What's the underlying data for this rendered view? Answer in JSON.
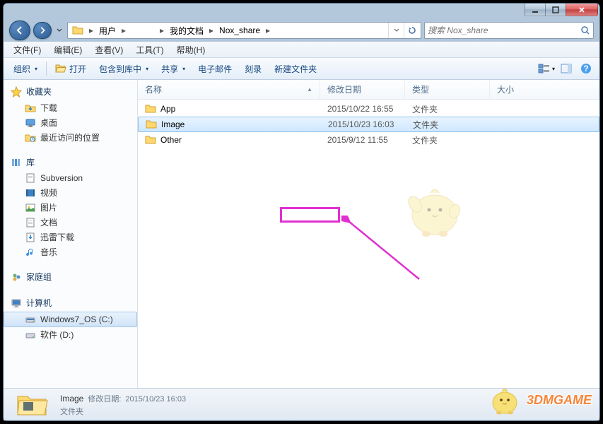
{
  "breadcrumb": {
    "segments": [
      "用户",
      "",
      "我的文档",
      "Nox_share"
    ]
  },
  "search": {
    "placeholder": "搜索 Nox_share"
  },
  "menu": {
    "file": "文件(F)",
    "edit": "编辑(E)",
    "view": "查看(V)",
    "tools": "工具(T)",
    "help": "帮助(H)"
  },
  "toolbar": {
    "organize": "组织",
    "open": "打开",
    "include": "包含到库中",
    "share": "共享",
    "email": "电子邮件",
    "burn": "刻录",
    "newfolder": "新建文件夹"
  },
  "sidebar": {
    "favorites": {
      "label": "收藏夹",
      "items": [
        "下载",
        "桌面",
        "最近访问的位置"
      ]
    },
    "libraries": {
      "label": "库",
      "items": [
        "Subversion",
        "视频",
        "图片",
        "文档",
        "迅雷下载",
        "音乐"
      ]
    },
    "homegroup": {
      "label": "家庭组"
    },
    "computer": {
      "label": "计算机",
      "items": [
        "Windows7_OS (C:)",
        "软件 (D:)"
      ]
    }
  },
  "columns": {
    "name": "名称",
    "date": "修改日期",
    "type": "类型",
    "size": "大小"
  },
  "folder_type": "文件夹",
  "rows": [
    {
      "name": "App",
      "date": "2015/10/22 16:55"
    },
    {
      "name": "Image",
      "date": "2015/10/23 16:03"
    },
    {
      "name": "Other",
      "date": "2015/9/12 11:55"
    }
  ],
  "selected_index": 1,
  "status": {
    "name": "Image",
    "mod_label": "修改日期:",
    "mod_value": "2015/10/23 16:03",
    "type": "文件夹"
  },
  "watermark": "3DMGAME"
}
